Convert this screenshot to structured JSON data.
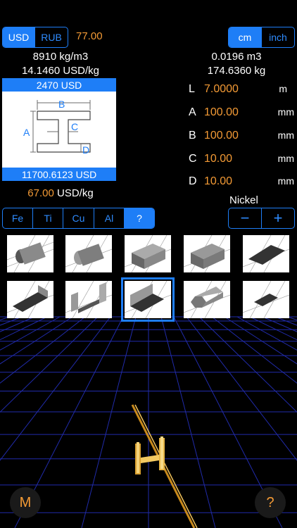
{
  "currency": {
    "options": [
      "USD",
      "RUB"
    ],
    "active": "USD",
    "rate": "77.00"
  },
  "units": {
    "options": [
      "cm",
      "inch"
    ],
    "active": "cm"
  },
  "summary_left": {
    "density": "8910 kg/m3",
    "price_per_kg": "14.1460 USD/kg"
  },
  "summary_right": {
    "volume": "0.0196 m3",
    "weight": "174.6360 kg"
  },
  "card": {
    "top_price": "2470 USD",
    "bottom_price": "11700.6123 USD",
    "labels": {
      "a": "A",
      "b": "B",
      "c": "C",
      "d": "D"
    }
  },
  "unit_price": {
    "value": "67.00",
    "unit": "USD/kg"
  },
  "dimensions": [
    {
      "label": "L",
      "value": "7.0000",
      "unit": "m"
    },
    {
      "label": "A",
      "value": "100.00",
      "unit": "mm"
    },
    {
      "label": "B",
      "value": "100.00",
      "unit": "mm"
    },
    {
      "label": "C",
      "value": "10.00",
      "unit": "mm"
    },
    {
      "label": "D",
      "value": "10.00",
      "unit": "mm"
    }
  ],
  "materials": {
    "options": [
      "Fe",
      "Ti",
      "Cu",
      "Al",
      "?"
    ],
    "active": "?"
  },
  "material_name": "Nickel",
  "stepper": {
    "minus": "−",
    "plus": "+"
  },
  "bottom": {
    "menu": "M",
    "help": "?"
  },
  "colors": {
    "accent": "#1e7ef7",
    "value": "#f39a35",
    "grid": "#2a3cff"
  }
}
